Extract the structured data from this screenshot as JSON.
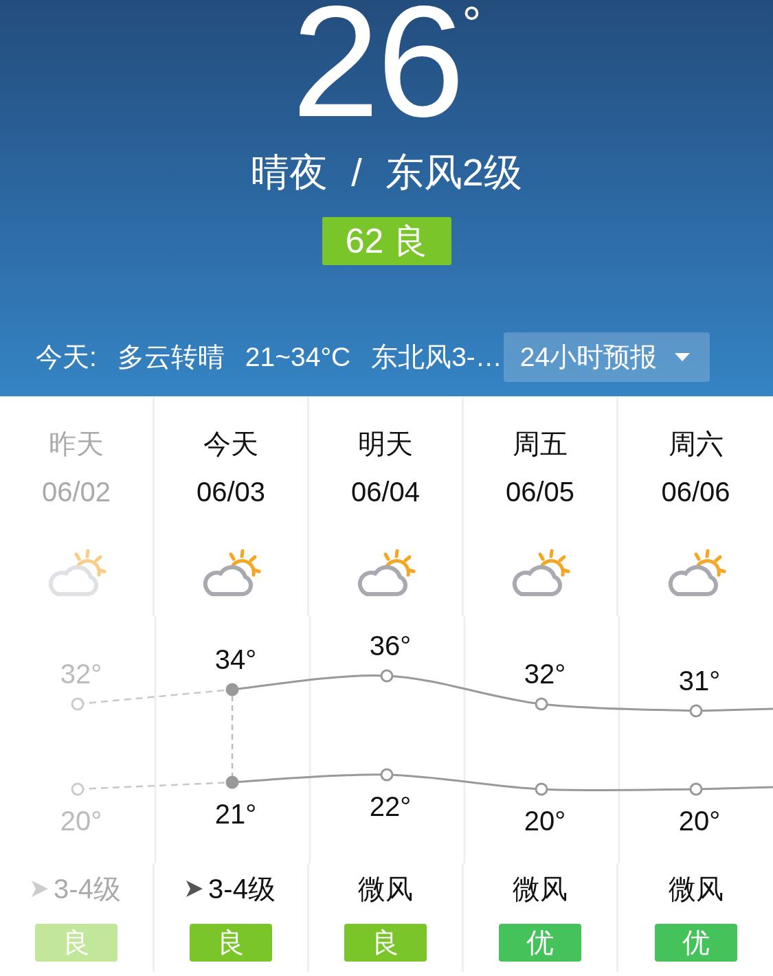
{
  "current": {
    "temperature": "26",
    "unit": "°",
    "condition": "晴夜",
    "separator": "/",
    "wind": "东风2级",
    "aqi": {
      "text": "62 良",
      "color": "#7ac52a"
    }
  },
  "today_summary": {
    "label": "今天:",
    "weather": "多云转晴",
    "range": "21~34°C",
    "wind": "东北风3-…",
    "dropdown": "24小时预报"
  },
  "days": [
    {
      "name": "昨天",
      "date": "06/02",
      "past": true,
      "today": false,
      "high": "32°",
      "low": "20°",
      "wind": "3-4级",
      "wind_arrow": true,
      "aqi": "良",
      "color": "#c3e79a"
    },
    {
      "name": "今天",
      "date": "06/03",
      "past": false,
      "today": true,
      "high": "34°",
      "low": "21°",
      "wind": "3-4级",
      "wind_arrow": true,
      "aqi": "良",
      "color": "#7ac52a"
    },
    {
      "name": "明天",
      "date": "06/04",
      "past": false,
      "today": false,
      "high": "36°",
      "low": "22°",
      "wind": "微风",
      "wind_arrow": false,
      "aqi": "良",
      "color": "#7ac52a"
    },
    {
      "name": "周五",
      "date": "06/05",
      "past": false,
      "today": false,
      "high": "32°",
      "low": "20°",
      "wind": "微风",
      "wind_arrow": false,
      "aqi": "优",
      "color": "#45c25a"
    },
    {
      "name": "周六",
      "date": "06/06",
      "past": false,
      "today": false,
      "high": "31°",
      "low": "20°",
      "wind": "微风",
      "wind_arrow": false,
      "aqi": "优",
      "color": "#45c25a"
    }
  ]
}
